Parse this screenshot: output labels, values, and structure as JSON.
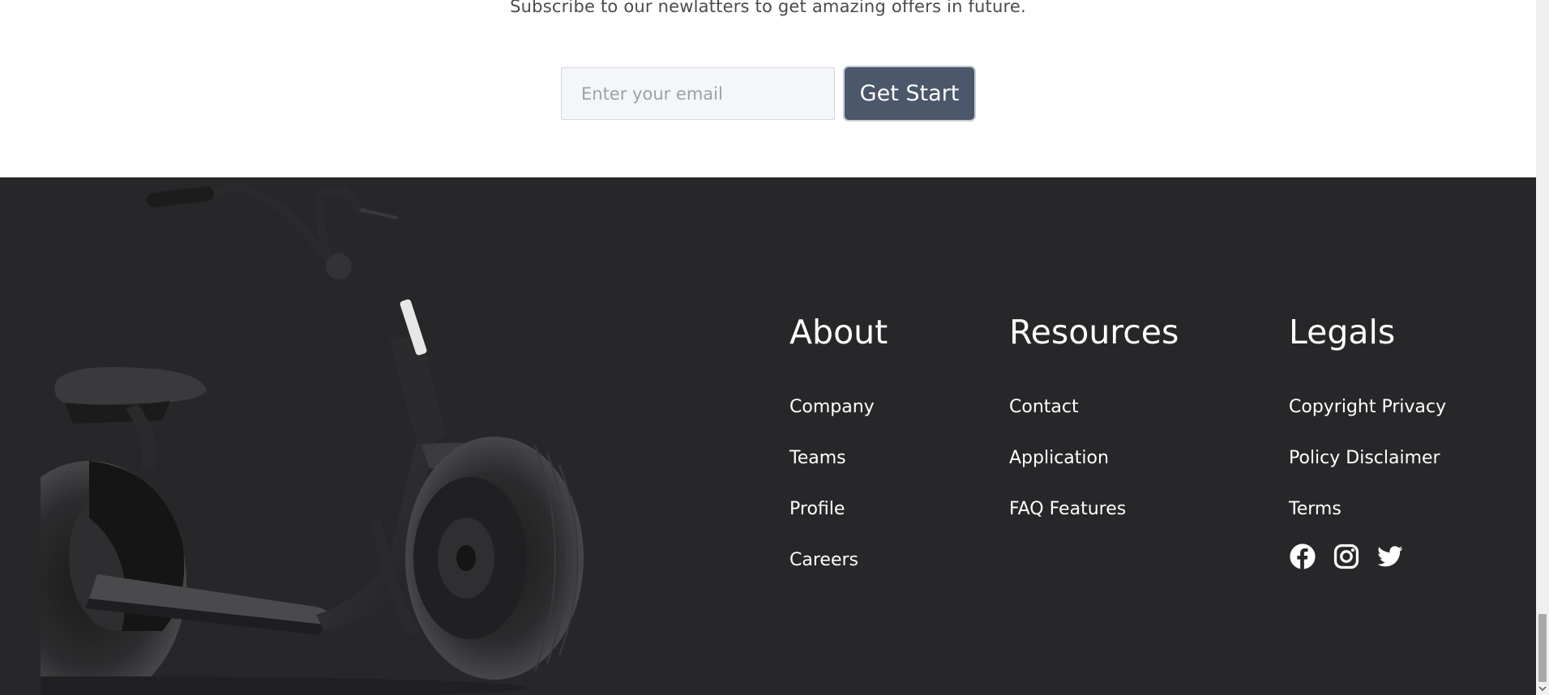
{
  "newsletter": {
    "subtitle": "Subscribe to our newlatters to get amazing offers in future.",
    "email_placeholder": "Enter your email",
    "button_label": "Get Start"
  },
  "footer": {
    "columns": [
      {
        "title": "About",
        "links": [
          "Company",
          "Teams",
          "Profile",
          "Careers"
        ]
      },
      {
        "title": "Resources",
        "links": [
          "Contact",
          "Application",
          "FAQ Features"
        ]
      },
      {
        "title": "Legals",
        "links": [
          "Copyright Privacy",
          "Policy Disclaimer",
          "Terms"
        ]
      }
    ],
    "social_icons": [
      "facebook-icon",
      "instagram-icon",
      "twitter-icon"
    ],
    "image": "scooter-image"
  },
  "colors": {
    "footer_bg": "#27272a",
    "button_bg": "#4b576a",
    "text_light": "#ffffff"
  }
}
